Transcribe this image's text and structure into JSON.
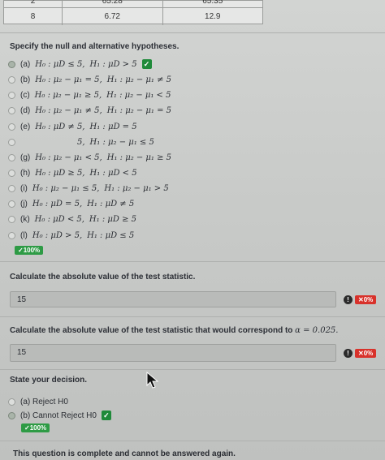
{
  "table": {
    "top_row": [
      "2",
      "65.28",
      "65.35"
    ],
    "bottom_row": [
      "8",
      "6.72",
      "12.9"
    ]
  },
  "hypotheses": {
    "prompt": "Specify the null and alternative hypotheses.",
    "options": [
      {
        "label": "(a)",
        "h0": "H₀ : μD ≤ 5,",
        "h1": "H₁ : μD > 5",
        "selected": true,
        "correct": true
      },
      {
        "label": "(b)",
        "h0": "H₀ : μ₂ − μ₁ = 5,",
        "h1": "H₁ : μ₂ − μ₁ ≠ 5",
        "selected": false
      },
      {
        "label": "(c)",
        "h0": "H₀ : μ₂ − μ₁ ≥ 5,",
        "h1": "H₁ : μ₂ − μ₁ < 5",
        "selected": false
      },
      {
        "label": "(d)",
        "h0": "H₀ : μ₂ − μ₁ ≠ 5,",
        "h1": "H₁ : μ₂ − μ₁ = 5",
        "selected": false
      },
      {
        "label": "(e)",
        "h0": "H₀ : μD ≠ 5,",
        "h1": "H₁ : μD = 5",
        "selected": false
      },
      {
        "label": "",
        "h0": "5,",
        "h1": "H₁ : μ₂ − μ₁ ≤ 5",
        "selected": false
      },
      {
        "label": "(g)",
        "h0": "H₀ : μ₂ − μ₁ < 5,",
        "h1": "H₁ : μ₂ − μ₁ ≥ 5",
        "selected": false
      },
      {
        "label": "(h)",
        "h0": "H₀ : μD ≥ 5,",
        "h1": "H₁ : μD < 5",
        "selected": false
      },
      {
        "label": "(i)",
        "h0": "H₀ : μ₂ − μ₁ ≤ 5,",
        "h1": "H₁ : μ₂ − μ₁ > 5",
        "selected": false
      },
      {
        "label": "(j)",
        "h0": "H₀ : μD = 5,",
        "h1": "H₁ : μD ≠ 5",
        "selected": false
      },
      {
        "label": "(k)",
        "h0": "H₀ : μD < 5,",
        "h1": "H₁ : μD ≥ 5",
        "selected": false
      },
      {
        "label": "(l)",
        "h0": "H₀ : μD > 5,",
        "h1": "H₁ : μD ≤ 5",
        "selected": false
      }
    ],
    "score": "✓100%"
  },
  "test_statistic": {
    "prompt": "Calculate the absolute value of the test statistic.",
    "value": "15",
    "score": "✕0%"
  },
  "critical_value": {
    "prompt_prefix": "Calculate the absolute value of the test statistic that would correspond to",
    "alpha": "α = 0.025.",
    "value": "15",
    "score": "✕0%"
  },
  "decision": {
    "prompt": "State your decision.",
    "options": [
      {
        "label": "(a) Reject H0",
        "selected": false
      },
      {
        "label": "(b) Cannot Reject H0",
        "selected": true,
        "correct": true
      }
    ],
    "score": "✓100%"
  },
  "footer": "This question is complete and cannot be answered again.",
  "icons": {
    "check": "check-icon",
    "error": "error-icon",
    "cursor": "cursor-icon"
  },
  "colors": {
    "correct": "#1f8a3a",
    "incorrect": "#d8322b"
  }
}
